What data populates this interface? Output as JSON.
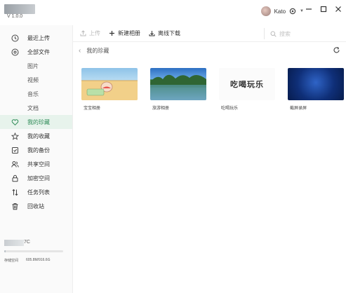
{
  "app": {
    "version": "V 1.0.0",
    "user": {
      "name": "Kato"
    }
  },
  "colors": {
    "accent": "#2e8b57",
    "active_bg": "#e7f3ec",
    "storage_fill": "#b9c0c7"
  },
  "sidebar": {
    "items": [
      {
        "label": "最近上传",
        "icon": "clock-icon"
      },
      {
        "label": "全部文件",
        "icon": "folder-icon"
      },
      {
        "label": "图片"
      },
      {
        "label": "视频"
      },
      {
        "label": "音乐"
      },
      {
        "label": "文档"
      },
      {
        "label": "我的珍藏",
        "icon": "heart-icon",
        "active": true
      },
      {
        "label": "我的收藏",
        "icon": "star-icon"
      },
      {
        "label": "我的备份",
        "icon": "backup-icon"
      },
      {
        "label": "共享空间",
        "icon": "share-users-icon"
      },
      {
        "label": "加密空间",
        "icon": "lock-icon"
      },
      {
        "label": "任务列表",
        "icon": "transfer-icon"
      },
      {
        "label": "回收站",
        "icon": "trash-icon"
      }
    ],
    "storage": {
      "suffix": "7C",
      "label": "存储空间",
      "value": "605.8M/916.6G",
      "used_fraction": 0.01
    }
  },
  "toolbar": {
    "upload_label": "上传",
    "new_album_label": "新建相册",
    "offline_download_label": "离线下载",
    "search_placeholder": "搜索"
  },
  "breadcrumb": {
    "current": "我的珍藏"
  },
  "albums": [
    {
      "name": "宝宝相册"
    },
    {
      "name": "旅游相册"
    },
    {
      "name": "吃喝玩乐",
      "cover_text": "吃喝玩乐"
    },
    {
      "name": "截屏录屏"
    }
  ]
}
